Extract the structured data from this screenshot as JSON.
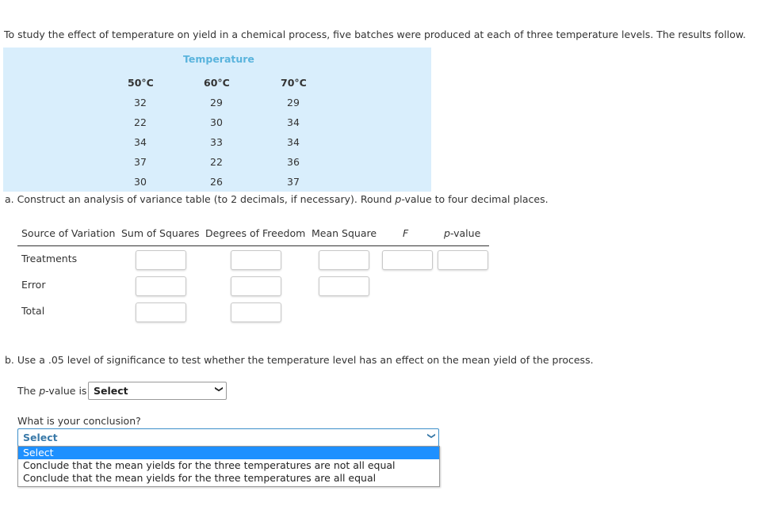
{
  "intro": "To study the effect of temperature on yield in a chemical process, five batches were produced at each of three temperature levels. The results follow.",
  "data_table": {
    "group_header": "Temperature",
    "columns": [
      "50°C",
      "60°C",
      "70°C"
    ],
    "rows": [
      [
        "32",
        "29",
        "29"
      ],
      [
        "22",
        "30",
        "34"
      ],
      [
        "34",
        "33",
        "34"
      ],
      [
        "37",
        "22",
        "36"
      ],
      [
        "30",
        "26",
        "37"
      ]
    ]
  },
  "part_a": {
    "text_before": "a. Construct an analysis of variance table (to 2 decimals, if necessary). Round ",
    "text_p": "p",
    "text_after": "-value to four decimal places.",
    "headers": {
      "source": "Source of Variation",
      "ss": "Sum of Squares",
      "df": "Degrees of Freedom",
      "ms": "Mean Square",
      "f": "F",
      "p_italic": "p",
      "p_rest": "-value"
    },
    "rows": [
      {
        "label": "Treatments",
        "ss": "",
        "df": "",
        "ms": "",
        "f": "",
        "p": ""
      },
      {
        "label": "Error",
        "ss": "",
        "df": "",
        "ms": ""
      },
      {
        "label": "Total",
        "ss": "",
        "df": ""
      }
    ]
  },
  "part_b": {
    "text": "b. Use a .05 level of significance to test whether the temperature level has an effect on the mean yield of the process.",
    "pvalue_label_before": "The ",
    "pvalue_label_p": "p",
    "pvalue_label_after": "-value is",
    "pvalue_select": "Select",
    "conclusion_label": "What is your conclusion?",
    "conclusion_select": "Select",
    "conclusion_options": [
      "Select",
      "Conclude that the mean yields for the three temperatures are not all equal",
      "Conclude that the mean yields for the three temperatures are all equal"
    ]
  }
}
